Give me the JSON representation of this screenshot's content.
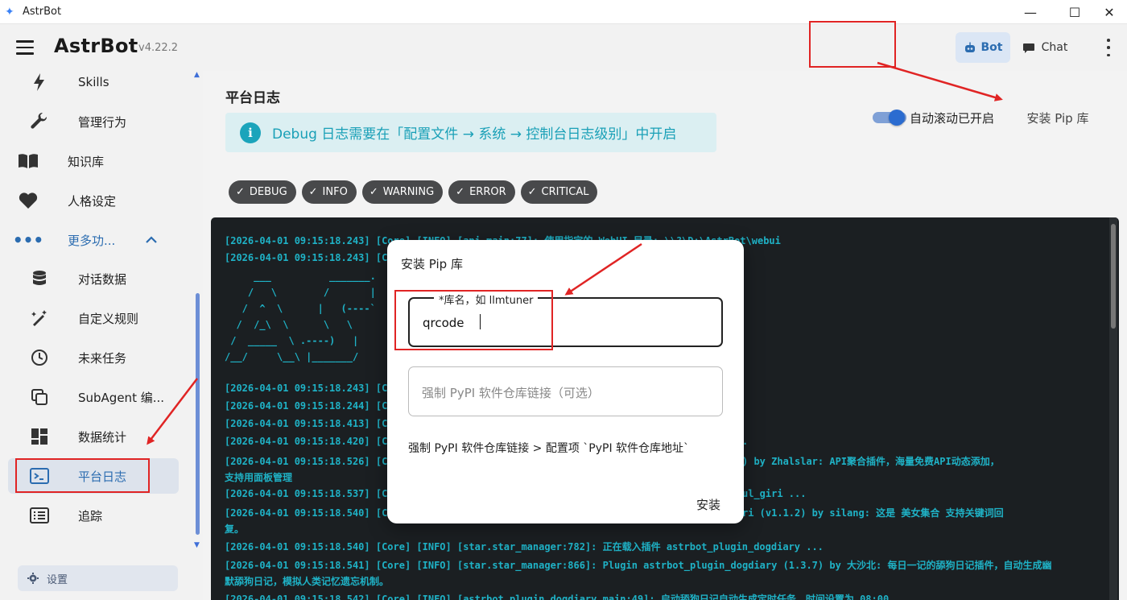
{
  "window": {
    "title": "AstrBot",
    "min": "—",
    "max": "☐",
    "close": "✕"
  },
  "header": {
    "brand": "AstrBot",
    "version": "v4.22.2",
    "bot_label": "Bot",
    "chat_label": "Chat"
  },
  "sidebar": {
    "items": [
      {
        "label": "Skills",
        "icon": "bolt-icon"
      },
      {
        "label": "管理行为",
        "icon": "wrench-icon"
      },
      {
        "label": "知识库",
        "icon": "book-icon"
      },
      {
        "label": "人格设定",
        "icon": "heart-icon"
      },
      {
        "label": "更多功...",
        "icon": "more-dots-icon"
      },
      {
        "label": "对话数据",
        "icon": "database-icon"
      },
      {
        "label": "自定义规则",
        "icon": "magic-wand-icon"
      },
      {
        "label": "未来任务",
        "icon": "clock-icon"
      },
      {
        "label": "SubAgent 编...",
        "icon": "copy-icon"
      },
      {
        "label": "数据统计",
        "icon": "dashboard-icon"
      },
      {
        "label": "平台日志",
        "icon": "console-icon"
      },
      {
        "label": "追踪",
        "icon": "list-icon"
      }
    ],
    "settings_label": "设置"
  },
  "main": {
    "title": "平台日志",
    "alert": "Debug 日志需要在「配置文件 → 系统 → 控制台日志级别」中开启",
    "autoscroll_label": "自动滚动已开启",
    "pip_button": "安装 Pip 库",
    "filters": [
      "DEBUG",
      "INFO",
      "WARNING",
      "ERROR",
      "CRITICAL"
    ],
    "logs": [
      "[2026-04-01 09:15:18.243] [Core] [INFO] [api.main:77]: 使用指定的 WebUI 目录: \\\\?\\D:\\AstrBot\\webui",
      "[2026-04-01 09:15:18.243] [C",
      "     ___          _______.",
      "    /   \\        /       |",
      "   /  ^  \\      |   (----`",
      "  /  /_\\  \\      \\   \\",
      " /  _____  \\ .----)   |",
      "/__/     \\__\\ |_______/",
      "[2026-04-01 09:15:18.243] [C",
      "[2026-04-01 09:15:18.244] [C",
      "[2026-04-01 09:15:18.413] [C",
      "[2026-04-01 09:15:18.420] [C                                                  gin_apis ...",
      "[2026-04-01 09:15:18.526] [C                                                  pis (v3.0.3) by Zhalslar: API聚合插件，海量免费API动态添加，",
      "支持用面板管理",
      "[2026-04-01 09:15:18.537] [C                                                  gin_beautiful_giri ...",
      "[2026-04-01 09:15:18.540] [C                                                  eautiful_giri (v1.1.2) by silang: 这是 美女集合 支持关键词回",
      "复。",
      "[2026-04-01 09:15:18.540] [Core] [INFO] [star.star_manager:782]: 正在载入插件 astrbot_plugin_dogdiary ...",
      "[2026-04-01 09:15:18.541] [Core] [INFO] [star.star_manager:866]: Plugin astrbot_plugin_dogdiary (1.3.7) by 大沙北: 每日一记的舔狗日记插件，自动生成幽",
      "默舔狗日记，模拟人类记忆遗忘机制。",
      "[2026-04-01 09:15:18.542] [Core] [INFO] [astrbot_plugin_dogdiary.main:49]: 启动舔狗日记自动生成定时任务，时间设置为 08:00"
    ]
  },
  "dialog": {
    "title": "安装 Pip 库",
    "package_label": "*库名，如 llmtuner",
    "package_value": "qrcode",
    "index_placeholder": "强制 PyPI 软件仓库链接（可选）",
    "hint": "强制 PyPI 软件仓库链接 > 配置项 `PyPI 软件仓库地址`",
    "install_label": "安装"
  },
  "colors": {
    "accent": "#2b6cb0",
    "annotation_red": "#e02424",
    "console_bg": "#1b1f22",
    "log_text": "#1fb2c6"
  }
}
